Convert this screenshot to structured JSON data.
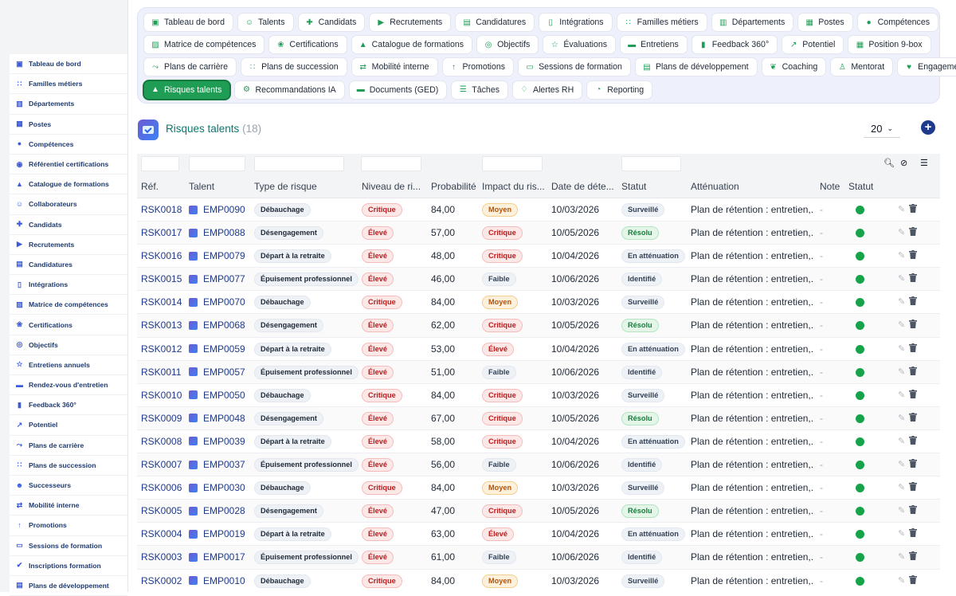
{
  "sidebar": {
    "items": [
      {
        "label": "Tableau de bord",
        "icon": "dashboard-icon"
      },
      {
        "label": "Familles métiers",
        "icon": "sitemap-icon"
      },
      {
        "label": "Départements",
        "icon": "building-icon"
      },
      {
        "label": "Postes",
        "icon": "badge-icon"
      },
      {
        "label": "Compétences",
        "icon": "brain-icon"
      },
      {
        "label": "Référentiel certifications",
        "icon": "certificate-icon"
      },
      {
        "label": "Catalogue de formations",
        "icon": "graduation-cap-icon"
      },
      {
        "label": "Collaborateurs",
        "icon": "user-icon"
      },
      {
        "label": "Candidats",
        "icon": "user-plus-icon"
      },
      {
        "label": "Recrutements",
        "icon": "megaphone-icon"
      },
      {
        "label": "Candidatures",
        "icon": "file-user-icon"
      },
      {
        "label": "Intégrations",
        "icon": "door-icon"
      },
      {
        "label": "Matrice de compétences",
        "icon": "grid-icon"
      },
      {
        "label": "Certifications",
        "icon": "award-icon"
      },
      {
        "label": "Objectifs",
        "icon": "target-icon"
      },
      {
        "label": "Entretiens annuels",
        "icon": "star-icon"
      },
      {
        "label": "Rendez-vous d'entretien",
        "icon": "chat-icon"
      },
      {
        "label": "Feedback 360°",
        "icon": "comment-icon"
      },
      {
        "label": "Potentiel",
        "icon": "chart-icon"
      },
      {
        "label": "Plans de carrière",
        "icon": "route-icon"
      },
      {
        "label": "Plans de succession",
        "icon": "sitemap-icon"
      },
      {
        "label": "Successeurs",
        "icon": "users-icon"
      },
      {
        "label": "Mobilité interne",
        "icon": "exchange-icon"
      },
      {
        "label": "Promotions",
        "icon": "arrow-up-icon"
      },
      {
        "label": "Sessions de formation",
        "icon": "chalkboard-icon"
      },
      {
        "label": "Inscriptions formation",
        "icon": "user-check-icon"
      },
      {
        "label": "Plans de développement",
        "icon": "clipboard-icon"
      }
    ]
  },
  "topnav": {
    "rows": [
      [
        {
          "label": "Tableau de bord",
          "icon": "dashboard-icon"
        },
        {
          "label": "Talents",
          "icon": "user-icon"
        },
        {
          "label": "Candidats",
          "icon": "user-plus-icon"
        },
        {
          "label": "Recrutements",
          "icon": "megaphone-icon"
        },
        {
          "label": "Candidatures",
          "icon": "file-user-icon"
        },
        {
          "label": "Intégrations",
          "icon": "door-icon"
        },
        {
          "label": "Familles métiers",
          "icon": "sitemap-icon"
        },
        {
          "label": "Départements",
          "icon": "building-icon"
        },
        {
          "label": "Postes",
          "icon": "badge-icon"
        },
        {
          "label": "Compétences",
          "icon": "brain-icon"
        }
      ],
      [
        {
          "label": "Matrice de compétences",
          "icon": "grid-icon"
        },
        {
          "label": "Certifications",
          "icon": "award-icon"
        },
        {
          "label": "Catalogue de formations",
          "icon": "graduation-cap-icon"
        },
        {
          "label": "Objectifs",
          "icon": "target-icon"
        },
        {
          "label": "Évaluations",
          "icon": "star-icon"
        },
        {
          "label": "Entretiens",
          "icon": "chat-icon"
        },
        {
          "label": "Feedback 360°",
          "icon": "comment-icon"
        },
        {
          "label": "Potentiel",
          "icon": "chart-icon"
        },
        {
          "label": "Position 9-box",
          "icon": "nine-grid-icon"
        }
      ],
      [
        {
          "label": "Plans de carrière",
          "icon": "route-icon"
        },
        {
          "label": "Plans de succession",
          "icon": "sitemap-icon"
        },
        {
          "label": "Mobilité interne",
          "icon": "exchange-icon"
        },
        {
          "label": "Promotions",
          "icon": "arrow-up-icon"
        },
        {
          "label": "Sessions de formation",
          "icon": "chalkboard-icon"
        },
        {
          "label": "Plans de développement",
          "icon": "clipboard-icon"
        },
        {
          "label": "Coaching",
          "icon": "handshake-icon"
        },
        {
          "label": "Mentorat",
          "icon": "mentor-icon"
        },
        {
          "label": "Engagement",
          "icon": "heart-icon"
        }
      ],
      [
        {
          "label": "Risques talents",
          "icon": "warning-icon",
          "active": true
        },
        {
          "label": "Recommandations IA",
          "icon": "robot-icon"
        },
        {
          "label": "Documents (GED)",
          "icon": "folder-icon"
        },
        {
          "label": "Tâches",
          "icon": "tasks-icon"
        },
        {
          "label": "Alertes RH",
          "icon": "bell-icon"
        },
        {
          "label": "Reporting",
          "icon": "pie-icon"
        }
      ]
    ]
  },
  "header": {
    "title": "Risques talents",
    "count": "(18)",
    "page_size": "20"
  },
  "table": {
    "columns": [
      "Réf.",
      "Talent",
      "Type de risque",
      "Niveau de ri...",
      "Probabilité",
      "Impact du ris...",
      "Date de déte...",
      "Statut",
      "Atténuation",
      "Note",
      "Statut"
    ],
    "rows": [
      {
        "ref": "RSK0018",
        "talent": "EMP0090",
        "type": "Débauchage",
        "level": "Critique",
        "prob": "84,00",
        "impact": "Moyen",
        "date": "10/03/2026",
        "status": "Surveillé",
        "mitigation": "Plan de rétention : entretien,...",
        "note": "-"
      },
      {
        "ref": "RSK0017",
        "talent": "EMP0088",
        "type": "Désengagement",
        "level": "Élevé",
        "prob": "57,00",
        "impact": "Critique",
        "date": "10/05/2026",
        "status": "Résolu",
        "mitigation": "Plan de rétention : entretien,...",
        "note": "-"
      },
      {
        "ref": "RSK0016",
        "talent": "EMP0079",
        "type": "Départ à la retraite",
        "level": "Élevé",
        "prob": "48,00",
        "impact": "Critique",
        "date": "10/04/2026",
        "status": "En atténuation",
        "mitigation": "Plan de rétention : entretien,...",
        "note": "-"
      },
      {
        "ref": "RSK0015",
        "talent": "EMP0077",
        "type": "Épuisement professionnel",
        "level": "Élevé",
        "prob": "46,00",
        "impact": "Faible",
        "date": "10/06/2026",
        "status": "Identifié",
        "mitigation": "Plan de rétention : entretien,...",
        "note": "-"
      },
      {
        "ref": "RSK0014",
        "talent": "EMP0070",
        "type": "Débauchage",
        "level": "Critique",
        "prob": "84,00",
        "impact": "Moyen",
        "date": "10/03/2026",
        "status": "Surveillé",
        "mitigation": "Plan de rétention : entretien,...",
        "note": "-"
      },
      {
        "ref": "RSK0013",
        "talent": "EMP0068",
        "type": "Désengagement",
        "level": "Élevé",
        "prob": "62,00",
        "impact": "Critique",
        "date": "10/05/2026",
        "status": "Résolu",
        "mitigation": "Plan de rétention : entretien,...",
        "note": "-"
      },
      {
        "ref": "RSK0012",
        "talent": "EMP0059",
        "type": "Départ à la retraite",
        "level": "Élevé",
        "prob": "53,00",
        "impact": "Élevé",
        "date": "10/04/2026",
        "status": "En atténuation",
        "mitigation": "Plan de rétention : entretien,...",
        "note": "-"
      },
      {
        "ref": "RSK0011",
        "talent": "EMP0057",
        "type": "Épuisement professionnel",
        "level": "Élevé",
        "prob": "51,00",
        "impact": "Faible",
        "date": "10/06/2026",
        "status": "Identifié",
        "mitigation": "Plan de rétention : entretien,...",
        "note": "-"
      },
      {
        "ref": "RSK0010",
        "talent": "EMP0050",
        "type": "Débauchage",
        "level": "Critique",
        "prob": "84,00",
        "impact": "Critique",
        "date": "10/03/2026",
        "status": "Surveillé",
        "mitigation": "Plan de rétention : entretien,...",
        "note": "-"
      },
      {
        "ref": "RSK0009",
        "talent": "EMP0048",
        "type": "Désengagement",
        "level": "Élevé",
        "prob": "67,00",
        "impact": "Critique",
        "date": "10/05/2026",
        "status": "Résolu",
        "mitigation": "Plan de rétention : entretien,...",
        "note": "-"
      },
      {
        "ref": "RSK0008",
        "talent": "EMP0039",
        "type": "Départ à la retraite",
        "level": "Élevé",
        "prob": "58,00",
        "impact": "Critique",
        "date": "10/04/2026",
        "status": "En atténuation",
        "mitigation": "Plan de rétention : entretien,...",
        "note": "-"
      },
      {
        "ref": "RSK0007",
        "talent": "EMP0037",
        "type": "Épuisement professionnel",
        "level": "Élevé",
        "prob": "56,00",
        "impact": "Faible",
        "date": "10/06/2026",
        "status": "Identifié",
        "mitigation": "Plan de rétention : entretien,...",
        "note": "-"
      },
      {
        "ref": "RSK0006",
        "talent": "EMP0030",
        "type": "Débauchage",
        "level": "Critique",
        "prob": "84,00",
        "impact": "Moyen",
        "date": "10/03/2026",
        "status": "Surveillé",
        "mitigation": "Plan de rétention : entretien,...",
        "note": "-"
      },
      {
        "ref": "RSK0005",
        "talent": "EMP0028",
        "type": "Désengagement",
        "level": "Élevé",
        "prob": "47,00",
        "impact": "Critique",
        "date": "10/05/2026",
        "status": "Résolu",
        "mitigation": "Plan de rétention : entretien,...",
        "note": "-"
      },
      {
        "ref": "RSK0004",
        "talent": "EMP0019",
        "type": "Départ à la retraite",
        "level": "Élevé",
        "prob": "63,00",
        "impact": "Élevé",
        "date": "10/04/2026",
        "status": "En atténuation",
        "mitigation": "Plan de rétention : entretien,...",
        "note": "-"
      },
      {
        "ref": "RSK0003",
        "talent": "EMP0017",
        "type": "Épuisement professionnel",
        "level": "Élevé",
        "prob": "61,00",
        "impact": "Faible",
        "date": "10/06/2026",
        "status": "Identifié",
        "mitigation": "Plan de rétention : entretien,...",
        "note": "-"
      },
      {
        "ref": "RSK0002",
        "talent": "EMP0010",
        "type": "Débauchage",
        "level": "Critique",
        "prob": "84,00",
        "impact": "Moyen",
        "date": "10/03/2026",
        "status": "Surveillé",
        "mitigation": "Plan de rétention : entretien,...",
        "note": "-"
      }
    ]
  },
  "colors": {
    "accent_green": "#1f9d55",
    "title_teal": "#0f766e",
    "link_navy": "#1e3a8a",
    "status_dot": "#16a34a"
  }
}
